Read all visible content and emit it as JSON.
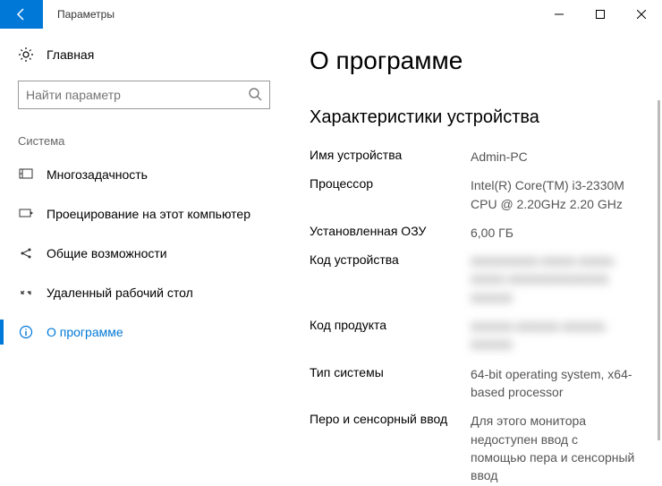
{
  "titlebar": {
    "title": "Параметры"
  },
  "sidebar": {
    "home_label": "Главная",
    "search_placeholder": "Найти параметр",
    "section_label": "Система",
    "items": [
      {
        "label": "Многозадачность"
      },
      {
        "label": "Проецирование на этот компьютер"
      },
      {
        "label": "Общие возможности"
      },
      {
        "label": "Удаленный рабочий стол"
      },
      {
        "label": "О программе"
      }
    ]
  },
  "main": {
    "page_title": "О программе",
    "section_title": "Характеристики устройства",
    "specs": {
      "device_name_label": "Имя устройства",
      "device_name_value": "Admin-PC",
      "processor_label": "Процессор",
      "processor_value": "Intel(R) Core(TM) i3-2330M CPU @ 2.20GHz 2.20 GHz",
      "ram_label": "Установленная ОЗУ",
      "ram_value": "6,00 ГБ",
      "device_id_label": "Код устройства",
      "device_id_value": "XXXXXXXX-XXXX-XXXX-XXXX-XXXXXXXXXXXX XXXXX",
      "product_id_label": "Код продукта",
      "product_id_value": "XXXXX-XXXXX-XXXXX-XXXXX",
      "system_type_label": "Тип системы",
      "system_type_value": "64-bit operating system, x64-based processor",
      "pen_touch_label": "Перо и сенсорный ввод",
      "pen_touch_value": "Для этого монитора недоступен ввод с помощью пера и сенсорный ввод"
    }
  }
}
